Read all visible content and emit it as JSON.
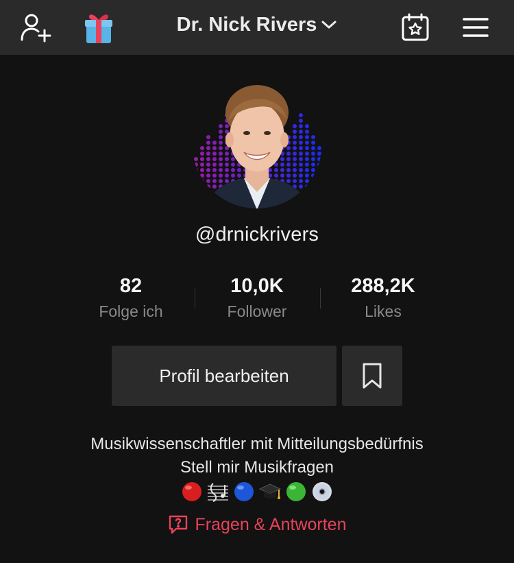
{
  "header": {
    "title": "Dr. Nick Rivers",
    "icons": [
      "add-user-icon",
      "gift-icon",
      "chevron-down-icon",
      "calendar-star-icon",
      "menu-icon"
    ]
  },
  "profile": {
    "handle": "@drnickrivers",
    "stats": [
      {
        "value": "82",
        "label": "Folge ich"
      },
      {
        "value": "10,0K",
        "label": "Follower"
      },
      {
        "value": "288,2K",
        "label": "Likes"
      }
    ],
    "edit_button": "Profil bearbeiten",
    "bio_line1": "Musikwissenschaftler mit Mitteilungsbedürfnis",
    "bio_line2": "Stell mir Musikfragen",
    "bio_emojis": [
      "red-circle",
      "musical-score",
      "blue-circle",
      "graduation-cap",
      "green-circle",
      "dvd"
    ],
    "qa_link": "Fragen & Antworten"
  },
  "colors": {
    "background": "#121212",
    "topbar": "#2a2a2a",
    "button": "#2b2b2b",
    "accent": "#e8425a",
    "muted": "#8a8a8a"
  }
}
